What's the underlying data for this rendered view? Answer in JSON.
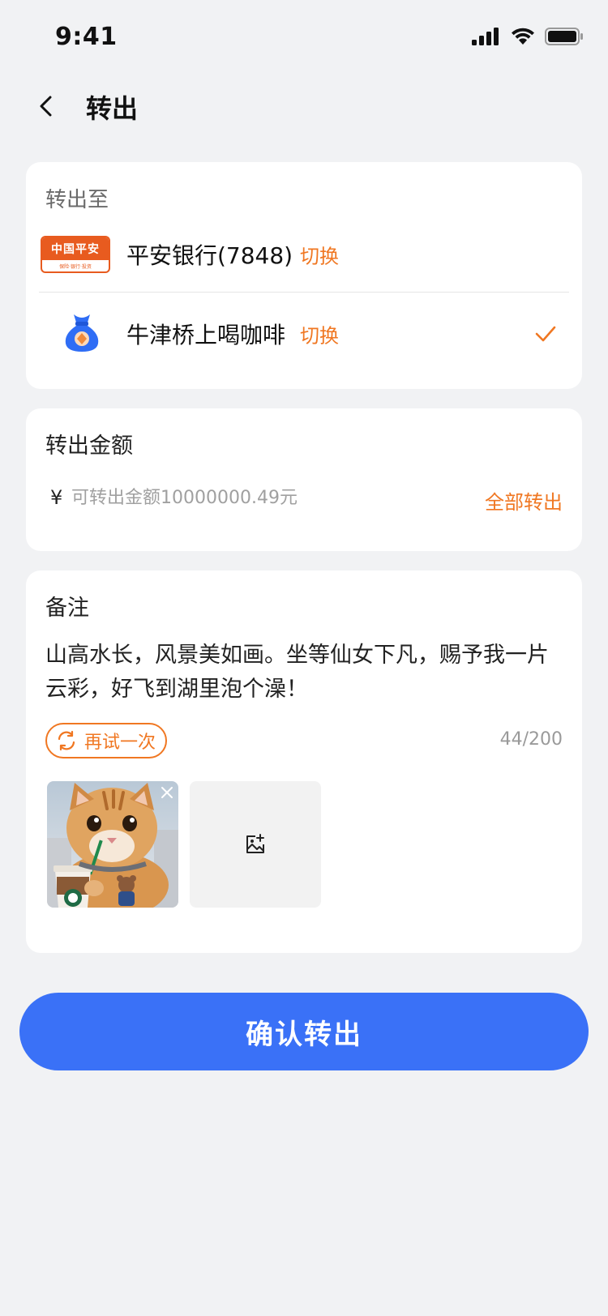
{
  "status_bar": {
    "time": "9:41"
  },
  "header": {
    "title": "转出"
  },
  "destination": {
    "label": "转出至",
    "bank": {
      "name": "平安银行(7848)",
      "switch_label": "切换",
      "logo_text": "中国平安",
      "logo_subtext": "保险·银行·投资"
    },
    "wallet": {
      "name": "牛津桥上喝咖啡",
      "switch_label": "切换",
      "selected": true
    }
  },
  "amount": {
    "title": "转出金额",
    "currency_symbol": "¥",
    "placeholder": "可转出金额10000000.49元",
    "all_label": "全部转出"
  },
  "note": {
    "title": "备注",
    "text": "山高水长，风景美如画。坐等仙女下凡，赐予我一片云彩，好飞到湖里泡个澡！",
    "retry_label": "再试一次",
    "char_count": "44/200"
  },
  "confirm": {
    "label": "确认转出"
  },
  "colors": {
    "accent": "#f07722",
    "primary": "#3a71f7",
    "background": "#f1f2f4",
    "bank_logo": "#e85b1f"
  }
}
